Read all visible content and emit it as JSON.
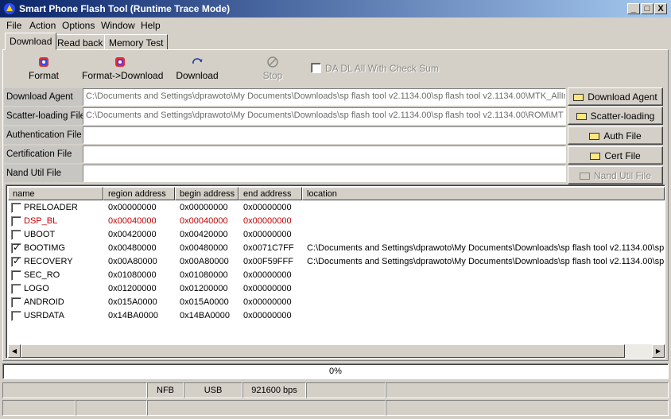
{
  "window": {
    "title": "Smart Phone Flash Tool (Runtime Trace Mode)",
    "minimize": "_",
    "maximize": "□",
    "close": "X"
  },
  "menu": [
    "File",
    "Action",
    "Options",
    "Window",
    "Help"
  ],
  "tabs": [
    "Download",
    "Read back",
    "Memory Test"
  ],
  "toolbar": {
    "format": "Format",
    "format_download": "Format->Download",
    "download": "Download",
    "stop": "Stop",
    "da_dl_checksum": "DA DL All With Check Sum"
  },
  "files": {
    "download_agent": {
      "label": "Download Agent",
      "value": "C:\\Documents and Settings\\dprawoto\\My Documents\\Downloads\\sp flash tool v2.1134.00\\sp flash tool v2.1134.00\\MTK_AllIn",
      "button": "Download Agent"
    },
    "scatter": {
      "label": "Scatter-loading File",
      "value": "C:\\Documents and Settings\\dprawoto\\My Documents\\Downloads\\sp flash tool v2.1134.00\\sp flash tool v2.1134.00\\ROM\\MT",
      "button": "Scatter-loading"
    },
    "auth": {
      "label": "Authentication File",
      "value": "",
      "button": "Auth File"
    },
    "cert": {
      "label": "Certification File",
      "value": "",
      "button": "Cert File"
    },
    "nand": {
      "label": "Nand Util File",
      "value": "",
      "button": "Nand Util File"
    }
  },
  "table": {
    "columns": [
      "name",
      "region address",
      "begin address",
      "end address",
      "location"
    ],
    "rows": [
      {
        "checked": false,
        "name": "PRELOADER",
        "region": "0x00000000",
        "begin": "0x00000000",
        "end": "0x00000000",
        "location": ""
      },
      {
        "checked": false,
        "name": "DSP_BL",
        "region": "0x00040000",
        "begin": "0x00040000",
        "end": "0x00000000",
        "location": ""
      },
      {
        "checked": false,
        "name": "UBOOT",
        "region": "0x00420000",
        "begin": "0x00420000",
        "end": "0x00000000",
        "location": ""
      },
      {
        "checked": true,
        "name": "BOOTIMG",
        "region": "0x00480000",
        "begin": "0x00480000",
        "end": "0x0071C7FF",
        "location": "C:\\Documents and Settings\\dprawoto\\My Documents\\Downloads\\sp flash tool v2.1134.00\\sp"
      },
      {
        "checked": true,
        "name": "RECOVERY",
        "region": "0x00A80000",
        "begin": "0x00A80000",
        "end": "0x00F59FFF",
        "location": "C:\\Documents and Settings\\dprawoto\\My Documents\\Downloads\\sp flash tool v2.1134.00\\sp"
      },
      {
        "checked": false,
        "name": "SEC_RO",
        "region": "0x01080000",
        "begin": "0x01080000",
        "end": "0x00000000",
        "location": ""
      },
      {
        "checked": false,
        "name": "LOGO",
        "region": "0x01200000",
        "begin": "0x01200000",
        "end": "0x00000000",
        "location": ""
      },
      {
        "checked": false,
        "name": "ANDROID",
        "region": "0x015A0000",
        "begin": "0x015A0000",
        "end": "0x00000000",
        "location": ""
      },
      {
        "checked": false,
        "name": "USRDATA",
        "region": "0x14BA0000",
        "begin": "0x14BA0000",
        "end": "0x00000000",
        "location": ""
      }
    ]
  },
  "progress": {
    "text": "0%",
    "value": 0
  },
  "status": {
    "nfb": "NFB",
    "usb": "USB",
    "baud": "921600 bps"
  },
  "colors": {
    "titlebar_start": "#0a246a",
    "titlebar_end": "#a6caf0",
    "error_red": "#c00000",
    "face": "#d4d0c8"
  }
}
